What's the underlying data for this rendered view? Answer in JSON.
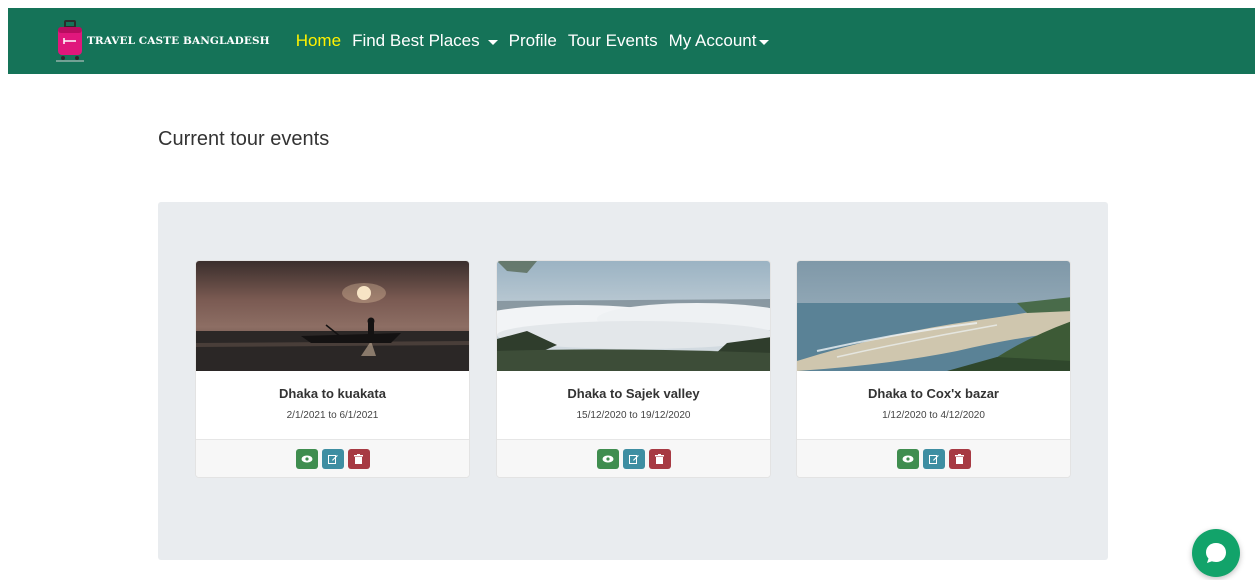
{
  "brand": {
    "name": "TRAVEL CASTE BANGLADESH"
  },
  "nav": {
    "home": "Home",
    "find_best_places": "Find Best Places",
    "profile": "Profile",
    "tour_events": "Tour Events",
    "my_account": "My Account"
  },
  "page": {
    "title": "Current tour events"
  },
  "events": [
    {
      "title": "Dhaka to kuakata",
      "dates": "2/1/2021 to 6/1/2021",
      "image": "sunset-boat-photo"
    },
    {
      "title": "Dhaka to Sajek valley",
      "dates": "15/12/2020 to 19/12/2020",
      "image": "cloud-valley-photo"
    },
    {
      "title": "Dhaka to Cox'x bazar",
      "dates": "1/12/2020 to 4/12/2020",
      "image": "beach-coast-photo"
    }
  ],
  "colors": {
    "navbar": "#157358",
    "active_link": "#fff200",
    "panel": "#e9ecef",
    "view_button": "#3f8d4f",
    "edit_button": "#3e8ea2",
    "delete_button": "#a73a43",
    "chat": "#12a36a"
  },
  "icons": {
    "view": "eye-icon",
    "edit": "edit-icon",
    "delete": "trash-icon",
    "chat": "chat-icon",
    "logo": "suitcase-logo"
  }
}
